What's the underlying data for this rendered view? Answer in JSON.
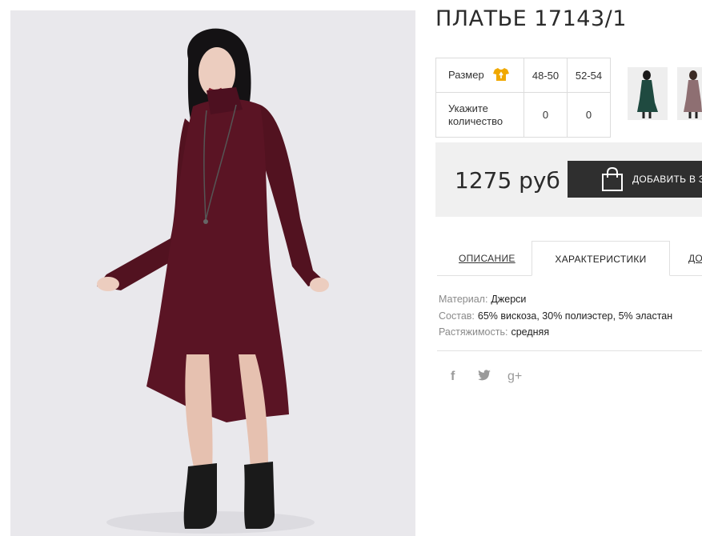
{
  "product": {
    "title": "ПЛАТЬЕ 17143/1"
  },
  "size_table": {
    "size_label": "Размер",
    "sizes": [
      "48-50",
      "52-54"
    ],
    "quantity_label": "Укажите количество",
    "quantities": [
      "0",
      "0"
    ]
  },
  "purchase": {
    "price": "1275 руб",
    "add_button_label": "ДОБАВИТЬ В З"
  },
  "tabs": [
    {
      "label": "ОПИСАНИЕ"
    },
    {
      "label": "ХАРАКТЕРИСТИКИ"
    },
    {
      "label": "ДО"
    }
  ],
  "characteristics": [
    {
      "key": "Материал:",
      "value": "Джерси"
    },
    {
      "key": "Состав:",
      "value": "65% вискоза, 30% полиэстер, 5% эластан"
    },
    {
      "key": "Растяжимость:",
      "value": "средняя"
    }
  ],
  "social": {
    "facebook": "f",
    "twitter": "t",
    "google_plus": "g+"
  },
  "colors": {
    "dress": "#5a1424",
    "size_icon": "#f0a800",
    "button_bg": "#2f2f2f",
    "buybox_bg": "#f0f0f0"
  },
  "icons": [
    "size-chart-tshirt-icon",
    "shopping-bag-icon",
    "facebook-icon",
    "twitter-icon",
    "google-plus-icon"
  ]
}
